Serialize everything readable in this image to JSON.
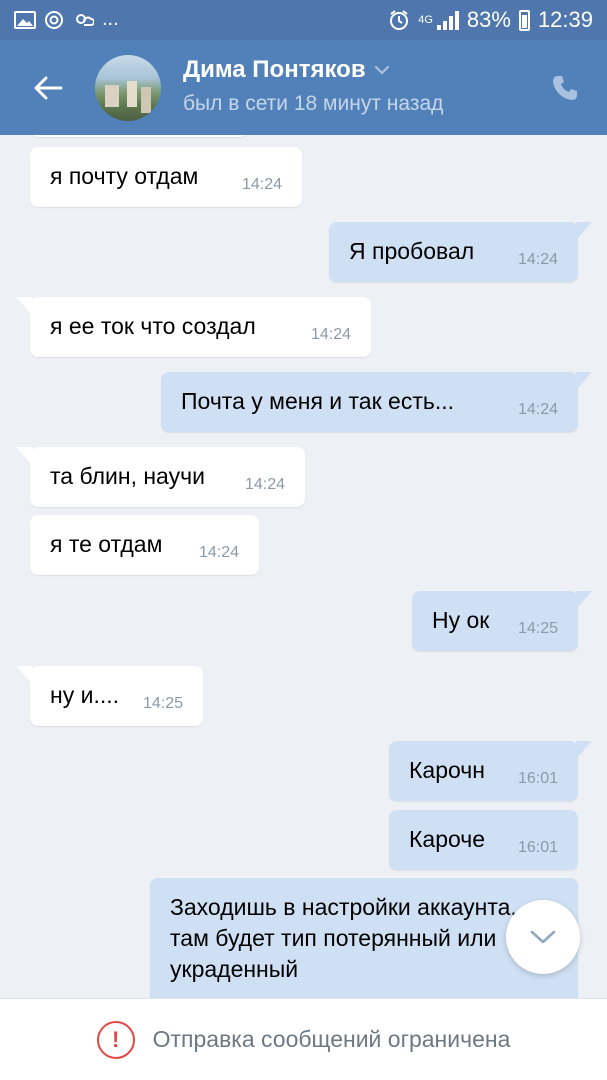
{
  "status_bar": {
    "network": "4G",
    "battery": "83%",
    "time": "12:39",
    "more": "..."
  },
  "header": {
    "name": "Дима Понтяков",
    "status": "был в сети 18 минут назад"
  },
  "messages": [
    {
      "direction": "in",
      "text": "я почту отдам",
      "time": "14:24"
    },
    {
      "direction": "out",
      "text": "Я  пробовал",
      "time": "14:24"
    },
    {
      "direction": "in",
      "text": "я ее ток что создал",
      "time": "14:24"
    },
    {
      "direction": "out",
      "text": "Почта у меня и так есть...",
      "time": "14:24"
    },
    {
      "direction": "in",
      "text": "та блин, научи",
      "time": "14:24"
    },
    {
      "direction": "in",
      "text": "я те отдам",
      "time": "14:24"
    },
    {
      "direction": "out",
      "text": "Ну ок",
      "time": "14:25"
    },
    {
      "direction": "in",
      "text": "ну и....",
      "time": "14:25"
    },
    {
      "direction": "out",
      "text": "Карочн",
      "time": "16:01"
    },
    {
      "direction": "out",
      "text": "Кароче",
      "time": "16:01"
    },
    {
      "direction": "out",
      "text": "Заходишь в настройки аккаунта... там будет тип потерянный или украденный",
      "time": ""
    }
  ],
  "footer": {
    "text": "Отправка сообщений ограничена"
  },
  "colors": {
    "status_bar": "#4f77ad",
    "header": "#5181b8",
    "background": "#edf0f5",
    "outgoing": "#cfe0f4",
    "incoming": "#ffffff",
    "warning": "#e64646"
  }
}
